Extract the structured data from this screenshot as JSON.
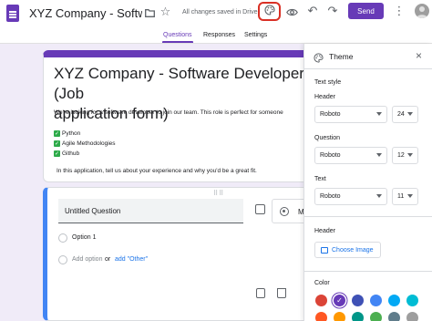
{
  "header": {
    "form_title": "XYZ Company - Software Developer (Job application form)",
    "saved_status": "All changes saved in Drive",
    "send_label": "Send"
  },
  "tabs": [
    {
      "label": "Questions",
      "active": true
    },
    {
      "label": "Responses",
      "active": false
    },
    {
      "label": "Settings",
      "active": false
    }
  ],
  "form": {
    "title": "XYZ Company - Software Developer (Job\napplication form)",
    "description": "We're looking for a software developer to join our team. This role is perfect for someone",
    "skills": [
      "Python",
      "Agile Methodologies",
      "Github"
    ],
    "closing": "In this application, tell us about your experience and why you'd be a great fit."
  },
  "question": {
    "title": "Untitled Question",
    "type_label": "Multiple choice",
    "option_1": "Option 1",
    "add_option": "Add option",
    "or": "or",
    "add_other": "add \"Other\""
  },
  "theme_panel": {
    "title": "Theme",
    "text_style_title": "Text style",
    "header_label": "Header",
    "header_font": "Roboto",
    "header_size": "24",
    "question_label": "Question",
    "question_font": "Roboto",
    "question_size": "12",
    "text_label": "Text",
    "text_font": "Roboto",
    "text_size": "11",
    "header_image_title": "Header",
    "choose_image_label": "Choose Image",
    "color_title": "Color",
    "colors_row1": [
      "#db4437",
      "#673ab7",
      "#3f51b5",
      "#4285f4",
      "#03a9f4",
      "#00bcd4"
    ],
    "colors_row2": [
      "#ff5722",
      "#ff9800",
      "#009688",
      "#4caf50",
      "#607d8b",
      "#9e9e9e"
    ],
    "selected_color": "#673ab7"
  },
  "icons": [
    "forms-icon",
    "folder-icon",
    "star-icon",
    "palette-icon",
    "preview-icon",
    "undo-icon",
    "redo-icon",
    "more-icon",
    "close-icon",
    "image-icon",
    "copy-icon",
    "delete-icon"
  ]
}
